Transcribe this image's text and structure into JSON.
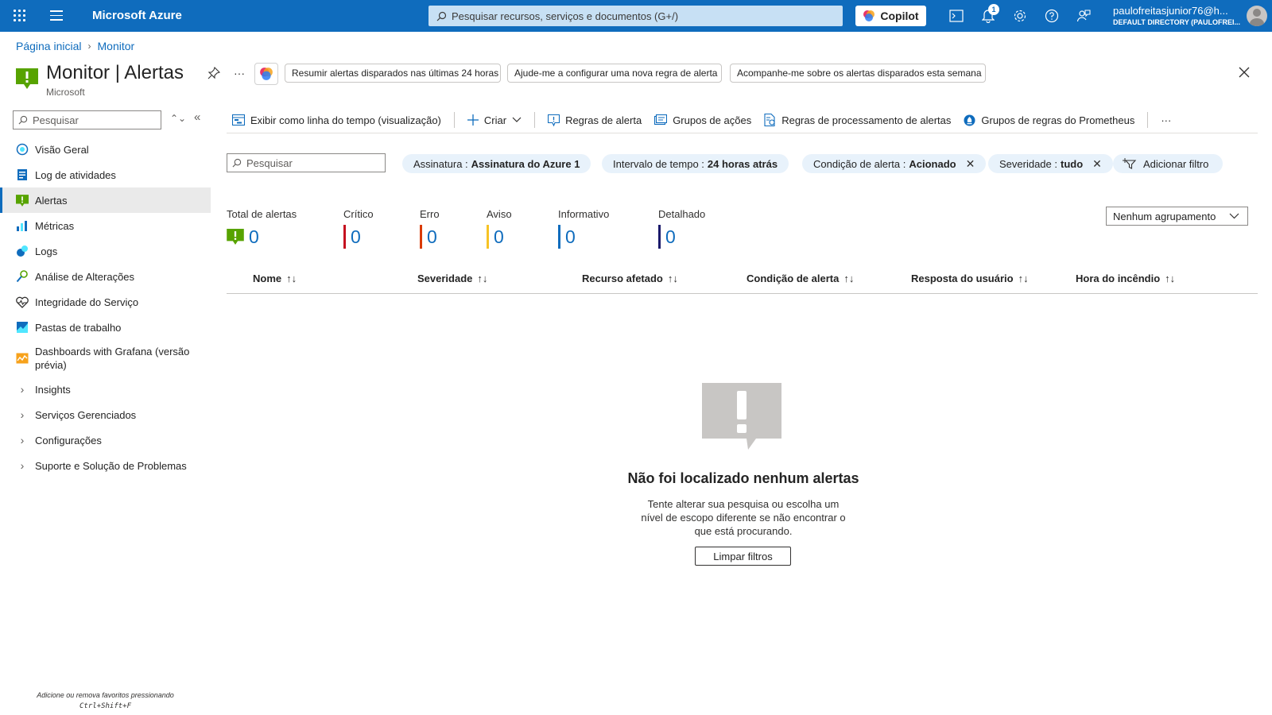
{
  "topbar": {
    "brand": "Microsoft Azure",
    "search_placeholder": "Pesquisar recursos, serviços e documentos (G+/)",
    "copilot_label": "Copilot",
    "notification_count": "1",
    "user_name": "paulofreitasjunior76@h...",
    "user_directory": "DEFAULT DIRECTORY (PAULOFREI..."
  },
  "breadcrumb": [
    "Página inicial",
    "Monitor"
  ],
  "page": {
    "title": "Monitor | Alertas",
    "subtitle": "Microsoft",
    "suggestions": [
      "Resumir alertas disparados nas últimas 24 horas",
      "Ajude-me a configurar uma nova regra de alerta",
      "Acompanhe-me sobre os alertas disparados esta semana"
    ]
  },
  "sidebar": {
    "search_placeholder": "Pesquisar",
    "items": [
      {
        "label": "Visão Geral",
        "icon": "overview-icon"
      },
      {
        "label": "Log de atividades",
        "icon": "activity-log-icon"
      },
      {
        "label": "Alertas",
        "icon": "alert-icon"
      },
      {
        "label": "Métricas",
        "icon": "metrics-icon"
      },
      {
        "label": "Logs",
        "icon": "logs-icon"
      },
      {
        "label": "Análise de Alterações",
        "icon": "change-analysis-icon"
      },
      {
        "label": "Integridade do Serviço",
        "icon": "service-health-icon"
      },
      {
        "label": "Pastas de trabalho",
        "icon": "workbooks-icon"
      },
      {
        "label": "Dashboards with Grafana (versão prévia)",
        "icon": "grafana-icon"
      }
    ],
    "groups": [
      "Insights",
      "Serviços Gerenciados",
      "Configurações",
      "Suporte e Solução de Problemas"
    ],
    "footer_line1": "Adicione ou remova favoritos pressionando",
    "footer_line2": "Ctrl+Shift+F"
  },
  "toolbar": {
    "timeline": "Exibir como linha do tempo (visualização)",
    "create": "Criar",
    "alert_rules": "Regras de alerta",
    "action_groups": "Grupos de ações",
    "processing_rules": "Regras de processamento de alertas",
    "prometheus_groups": "Grupos de regras do Prometheus"
  },
  "filters": {
    "search_placeholder": "Pesquisar",
    "subscription_key": "Assinatura :",
    "subscription_val": "Assinatura do Azure 1",
    "time_key": "Intervalo de tempo :",
    "time_val": "24 horas atrás",
    "condition_key": "Condição de alerta :",
    "condition_val": "Acionado",
    "severity_key": "Severidade :",
    "severity_val": "tudo",
    "add_filter": "Adicionar filtro"
  },
  "summary": {
    "total_label": "Total de alertas",
    "total": "0",
    "critical_label": "Crítico",
    "critical": "0",
    "error_label": "Erro",
    "error": "0",
    "warning_label": "Aviso",
    "warning": "0",
    "info_label": "Informativo",
    "info": "0",
    "verbose_label": "Detalhado",
    "verbose": "0",
    "grouping": "Nenhum agrupamento"
  },
  "colors": {
    "brand": "#0f6cbd",
    "critical": "#c50f1f",
    "error": "#da3b01",
    "warning": "#f7c325",
    "info": "#0f6cbd",
    "verbose": "#1b1a6b",
    "alert_green": "#57a300"
  },
  "table": {
    "columns": [
      "Nome",
      "Severidade",
      "Recurso afetado",
      "Condição de alerta",
      "Resposta do usuário",
      "Hora do incêndio"
    ]
  },
  "empty": {
    "title": "Não foi localizado nenhum alertas",
    "description": "Tente alterar sua pesquisa ou escolha um nível de escopo diferente se não encontrar o que está procurando.",
    "clear_button": "Limpar filtros"
  }
}
